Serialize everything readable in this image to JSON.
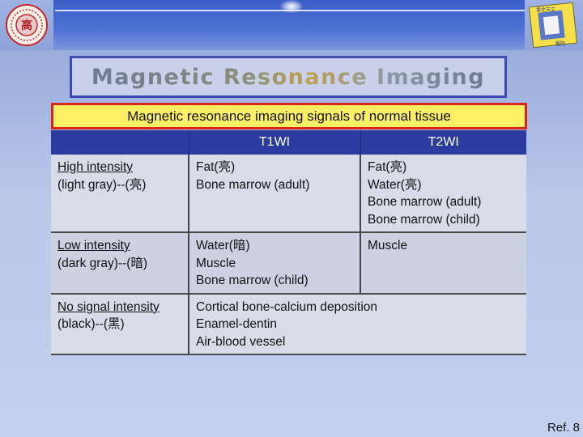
{
  "header": {
    "title": "Magnetic Resonance Imaging",
    "subtitle": "Magnetic resonance imaging signals of normal tissue"
  },
  "logos": {
    "left": "university-seal",
    "right": "department-emblem",
    "left_text": "高",
    "right_text_1": "臺北市立",
    "right_text_2": "醫院"
  },
  "table": {
    "headers": [
      "",
      "T1WI",
      "T2WI"
    ],
    "rows": [
      {
        "label_line1": "High intensity",
        "label_line2": "(light gray)--(亮)",
        "t1": [
          "Fat(亮)",
          "Bone marrow (adult)"
        ],
        "t2": [
          "Fat(亮)",
          "Water(亮)",
          "Bone marrow (adult)",
          "Bone marrow (child)"
        ]
      },
      {
        "label_line1": "Low intensity",
        "label_line2": "(dark gray)--(暗)",
        "t1": [
          "Water(暗)",
          "Muscle",
          "Bone marrow (child)"
        ],
        "t2": [
          "Muscle"
        ]
      },
      {
        "label_line1": "No signal intensity",
        "label_line2": "(black)--(黑)",
        "merged": [
          "Cortical bone-calcium deposition",
          "Enamel-dentin",
          "Air-blood vessel"
        ]
      }
    ]
  },
  "footer": {
    "ref": "Ref. 8"
  },
  "colors": {
    "header_bar": "#2b3ba0",
    "subtitle_bg": "#fdf064",
    "subtitle_border": "#d8261d",
    "title_border": "#3b4bb0"
  }
}
